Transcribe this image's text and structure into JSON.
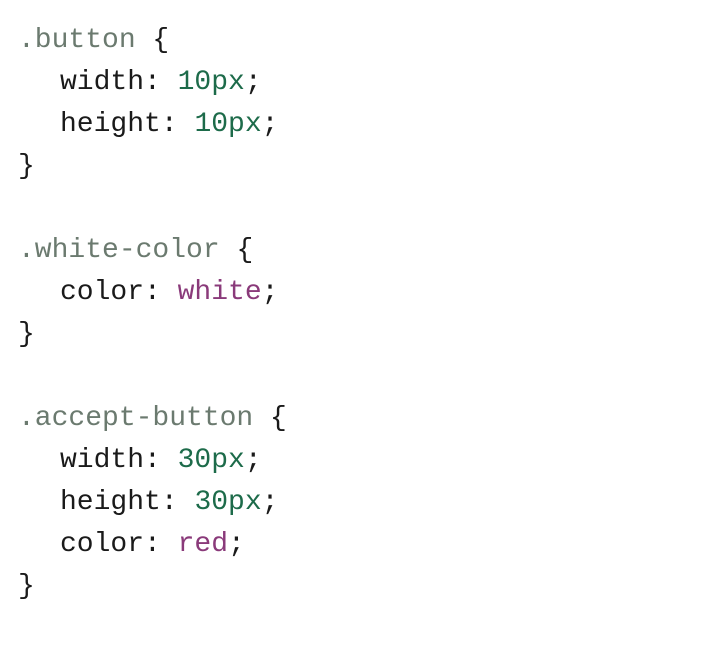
{
  "rules": [
    {
      "selector": ".button",
      "declarations": [
        {
          "property": "width",
          "value": "10px",
          "valueType": "number"
        },
        {
          "property": "height",
          "value": "10px",
          "valueType": "number"
        }
      ]
    },
    {
      "selector": ".white-color",
      "declarations": [
        {
          "property": "color",
          "value": "white",
          "valueType": "color"
        }
      ]
    },
    {
      "selector": ".accept-button",
      "declarations": [
        {
          "property": "width",
          "value": "30px",
          "valueType": "number"
        },
        {
          "property": "height",
          "value": "30px",
          "valueType": "number"
        },
        {
          "property": "color",
          "value": "red",
          "valueType": "color"
        }
      ]
    }
  ],
  "punct": {
    "open": " {",
    "close": "}",
    "colon": ": ",
    "semi": ";"
  }
}
